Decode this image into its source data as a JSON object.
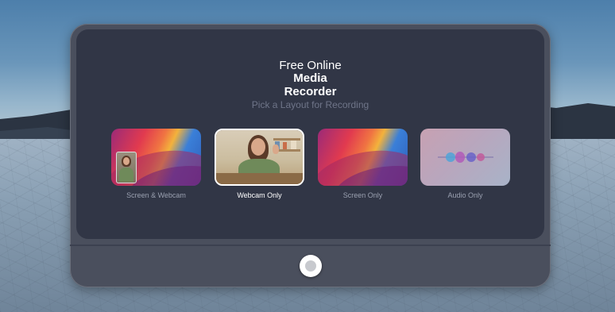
{
  "page": {
    "title_line1": "Free Online",
    "title_line2": "Media",
    "title_line3": "Recorder",
    "subtitle": "Pick a Layout for Recording"
  },
  "layouts": [
    {
      "label": "Screen & Webcam",
      "icon": "wallpaper-with-webcam-thumbnail",
      "selected": false
    },
    {
      "label": "Webcam Only",
      "icon": "webcam-person-thumbnail",
      "selected": true
    },
    {
      "label": "Screen Only",
      "icon": "wallpaper-thumbnail",
      "selected": false
    },
    {
      "label": "Audio Only",
      "icon": "audio-wave-thumbnail",
      "selected": false
    }
  ],
  "controls": {
    "record_button_icon": "record-icon"
  },
  "colors": {
    "panel": "#313646",
    "frame": "#4a4f5d",
    "subtitle": "#6f7589",
    "label": "#9aa0b0",
    "selected_label": "#ffffff"
  }
}
